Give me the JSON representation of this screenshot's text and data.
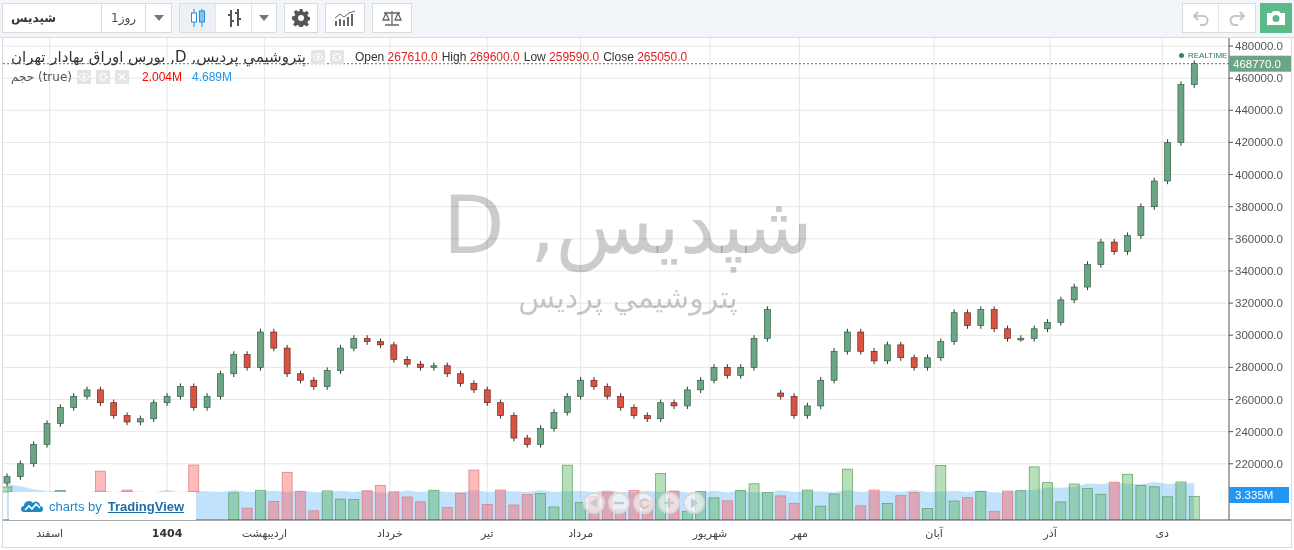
{
  "toolbar": {
    "symbol": "شپديس",
    "interval": "1روز",
    "chart_styles": [
      {
        "kind": "candles",
        "selected": true
      },
      {
        "kind": "bars",
        "selected": false
      }
    ],
    "undo": {
      "disabled": true
    },
    "redo": {
      "disabled": true
    }
  },
  "legend": {
    "title": "پتروشيمي پرديس, D, بورس اوراق بهادار تهران",
    "ohlc": [
      "Close 265050.0",
      "Low 259590.0",
      "High 269600.0",
      "Open 267610.0"
    ]
  },
  "volume_legend": {
    "title": "حجم (true)",
    "values": [
      {
        "text": "4.689M",
        "color": "#2196f3"
      },
      {
        "text": "2.004M",
        "color": "#ff0000"
      }
    ]
  },
  "watermark": {
    "symbol": "شپديس, D",
    "name": "پتروشيمي پرديس"
  },
  "realtime": "REALTIME",
  "last_price": "468770.0",
  "volume_tag": "3.335M",
  "chart_data": {
    "type": "candlestick",
    "ylim": [
      185000,
      485000
    ],
    "grid": true,
    "ohlc": [
      [
        208000,
        214000,
        206000,
        212000
      ],
      [
        212000,
        222000,
        210000,
        220000
      ],
      [
        220000,
        234000,
        218000,
        232000
      ],
      [
        232000,
        247000,
        230000,
        245000
      ],
      [
        245000,
        257000,
        243000,
        255000
      ],
      [
        255000,
        264000,
        253000,
        262000
      ],
      [
        262000,
        268000,
        260000,
        266000
      ],
      [
        266000,
        268000,
        256000,
        258000
      ],
      [
        258000,
        260000,
        248000,
        250000
      ],
      [
        250000,
        252000,
        244000,
        246000
      ],
      [
        246000,
        250000,
        244000,
        248000
      ],
      [
        248000,
        260000,
        246000,
        258000
      ],
      [
        258000,
        264000,
        256000,
        262000
      ],
      [
        262000,
        270000,
        260000,
        268000
      ],
      [
        268000,
        270000,
        253000,
        255000
      ],
      [
        255000,
        264000,
        253000,
        262000
      ],
      [
        262000,
        278000,
        260000,
        276000
      ],
      [
        276000,
        290000,
        274000,
        288000
      ],
      [
        288000,
        290000,
        278000,
        280000
      ],
      [
        280000,
        304000,
        278000,
        302000
      ],
      [
        302000,
        304000,
        290000,
        292000
      ],
      [
        292000,
        294000,
        274000,
        276000
      ],
      [
        276000,
        278000,
        270000,
        272000
      ],
      [
        272000,
        274000,
        266000,
        268000
      ],
      [
        268000,
        280000,
        266000,
        278000
      ],
      [
        278000,
        294000,
        276000,
        292000
      ],
      [
        292000,
        300000,
        290000,
        298000
      ],
      [
        298000,
        300000,
        294000,
        296000
      ],
      [
        296000,
        298000,
        292000,
        294000
      ],
      [
        294000,
        296000,
        283000,
        285000
      ],
      [
        285000,
        287000,
        280000,
        282000
      ],
      [
        282000,
        284000,
        278000,
        280000
      ],
      [
        280000,
        283000,
        278000,
        281000
      ],
      [
        281000,
        283000,
        274000,
        276000
      ],
      [
        276000,
        278000,
        268000,
        270000
      ],
      [
        270000,
        272000,
        264000,
        266000
      ],
      [
        266000,
        268000,
        256000,
        258000
      ],
      [
        258000,
        260000,
        248000,
        250000
      ],
      [
        250000,
        252000,
        234000,
        236000
      ],
      [
        236000,
        238000,
        230000,
        232000
      ],
      [
        232000,
        244000,
        230000,
        242000
      ],
      [
        242000,
        254000,
        240000,
        252000
      ],
      [
        252000,
        264000,
        250000,
        262000
      ],
      [
        262000,
        274000,
        260000,
        272000
      ],
      [
        272000,
        274000,
        266000,
        268000
      ],
      [
        268000,
        270000,
        260000,
        262000
      ],
      [
        262000,
        264000,
        253000,
        255000
      ],
      [
        255000,
        257000,
        248000,
        250000
      ],
      [
        250000,
        252000,
        246000,
        248000
      ],
      [
        248000,
        260000,
        246000,
        258000
      ],
      [
        258000,
        260000,
        254000,
        256000
      ],
      [
        256000,
        268000,
        254000,
        266000
      ],
      [
        266000,
        274000,
        264000,
        272000
      ],
      [
        272000,
        282000,
        270000,
        280000
      ],
      [
        280000,
        282000,
        273000,
        275000
      ],
      [
        275000,
        282000,
        273000,
        280000
      ],
      [
        280000,
        300000,
        278000,
        298000
      ],
      [
        298000,
        318000,
        296000,
        316000
      ],
      [
        264000,
        266000,
        260000,
        262000
      ],
      [
        262000,
        264000,
        248000,
        250000
      ],
      [
        250000,
        258000,
        248000,
        256000
      ],
      [
        256000,
        274000,
        254000,
        272000
      ],
      [
        272000,
        292000,
        270000,
        290000
      ],
      [
        290000,
        304000,
        288000,
        302000
      ],
      [
        302000,
        304000,
        288000,
        290000
      ],
      [
        290000,
        292000,
        282000,
        284000
      ],
      [
        284000,
        296000,
        282000,
        294000
      ],
      [
        294000,
        296000,
        284000,
        286000
      ],
      [
        286000,
        288000,
        278000,
        280000
      ],
      [
        280000,
        288000,
        278000,
        286000
      ],
      [
        286000,
        298000,
        284000,
        296000
      ],
      [
        296000,
        316000,
        294000,
        314000
      ],
      [
        314000,
        316000,
        304000,
        306000
      ],
      [
        306000,
        318000,
        304000,
        316000
      ],
      [
        316000,
        318000,
        302000,
        304000
      ],
      [
        304000,
        306000,
        296000,
        298000
      ],
      [
        298000,
        300000,
        296000,
        298000
      ],
      [
        298000,
        306000,
        296000,
        304000
      ],
      [
        304000,
        310000,
        302000,
        308000
      ],
      [
        308000,
        324000,
        306000,
        322000
      ],
      [
        322000,
        332000,
        320000,
        330000
      ],
      [
        330000,
        346000,
        328000,
        344000
      ],
      [
        344000,
        360000,
        342000,
        358000
      ],
      [
        358000,
        360000,
        350000,
        352000
      ],
      [
        352000,
        364000,
        350000,
        362000
      ],
      [
        362000,
        382000,
        360000,
        380000
      ],
      [
        380000,
        398000,
        378000,
        396000
      ],
      [
        396000,
        422000,
        394000,
        420000
      ],
      [
        420000,
        458000,
        418000,
        456000
      ],
      [
        456000,
        471000,
        454000,
        469000
      ]
    ],
    "yticks": [
      {
        "value": 220000,
        "label": "220000.0"
      },
      {
        "value": 240000,
        "label": "240000.0"
      },
      {
        "value": 260000,
        "label": "260000.0"
      },
      {
        "value": 280000,
        "label": "280000.0"
      },
      {
        "value": 300000,
        "label": "300000.0"
      },
      {
        "value": 320000,
        "label": "320000.0"
      },
      {
        "value": 340000,
        "label": "340000.0"
      },
      {
        "value": 360000,
        "label": "360000.0"
      },
      {
        "value": 380000,
        "label": "380000.0"
      },
      {
        "value": 400000,
        "label": "400000.0"
      },
      {
        "value": 420000,
        "label": "420000.0"
      },
      {
        "value": 440000,
        "label": "440000.0"
      },
      {
        "value": 460000,
        "label": "460000.0"
      },
      {
        "value": 480000,
        "label": "480000.0"
      }
    ],
    "relative": false
  },
  "time_axis": [
    {
      "label": "دی",
      "kind": "month"
    },
    {
      "label": "آذر",
      "kind": "month"
    },
    {
      "label": "آبان",
      "kind": "month"
    },
    {
      "label": "مهر",
      "kind": "month"
    },
    {
      "label": "شهريور",
      "kind": "month"
    },
    {
      "label": "مرداد",
      "kind": "month"
    },
    {
      "label": "تير",
      "kind": "month"
    },
    {
      "label": "خرداد",
      "kind": "month"
    },
    {
      "label": "ارديبهشت",
      "kind": "month"
    },
    {
      "label": "1404",
      "kind": "year"
    },
    {
      "label": "اسفند",
      "kind": "month"
    }
  ],
  "logo": {
    "prefix": "charts by",
    "brand": "TradingView"
  }
}
